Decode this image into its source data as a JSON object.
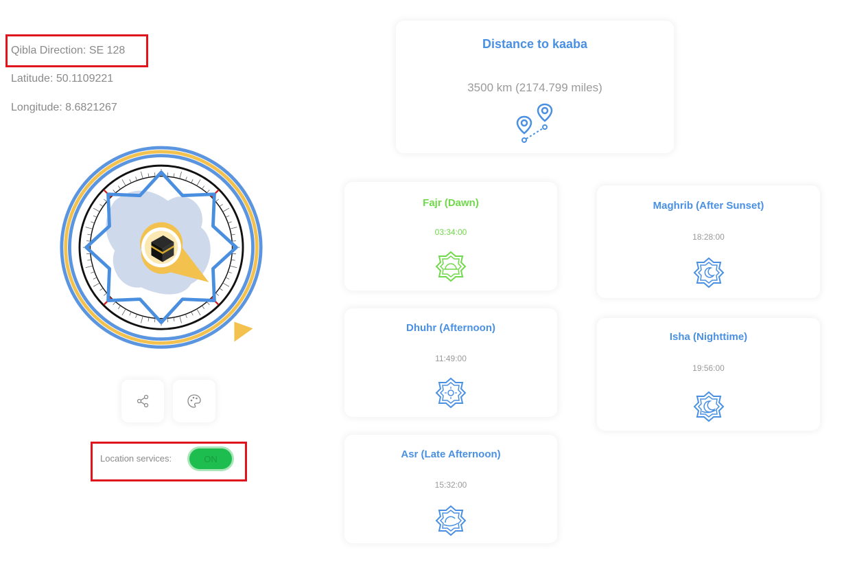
{
  "location": {
    "qibla_direction": "Qibla Direction: SE 128",
    "latitude": "Latitude: 50.1109221",
    "longitude": "Longitude: 8.6821267"
  },
  "distance": {
    "title": "Distance to kaaba",
    "value": "3500 km (2174.799 miles)",
    "icon": "map-pins-icon"
  },
  "prayers": [
    {
      "name": "Fajr (Dawn)",
      "time": "03:34:00",
      "icon": "fajr-icon"
    },
    {
      "name": "Dhuhr (Afternoon)",
      "time": "11:49:00",
      "icon": "sun-icon"
    },
    {
      "name": "Asr (Late Afternoon)",
      "time": "15:32:00",
      "icon": "asr-icon"
    },
    {
      "name": "Maghrib (After Sunset)",
      "time": "18:28:00",
      "icon": "moon-icon"
    },
    {
      "name": "Isha (Nighttime)",
      "time": "19:56:00",
      "icon": "isha-icon"
    }
  ],
  "controls": {
    "location_label": "Location services:",
    "location_toggle": "ON",
    "share_icon": "share-icon",
    "palette_icon": "palette-icon"
  },
  "colors": {
    "accent_blue": "#4a90e2",
    "active_green": "#6fd94a",
    "toggle_green": "#1ebd4f",
    "compass_gold": "#f2c14e",
    "highlight_red": "#e0141c"
  }
}
